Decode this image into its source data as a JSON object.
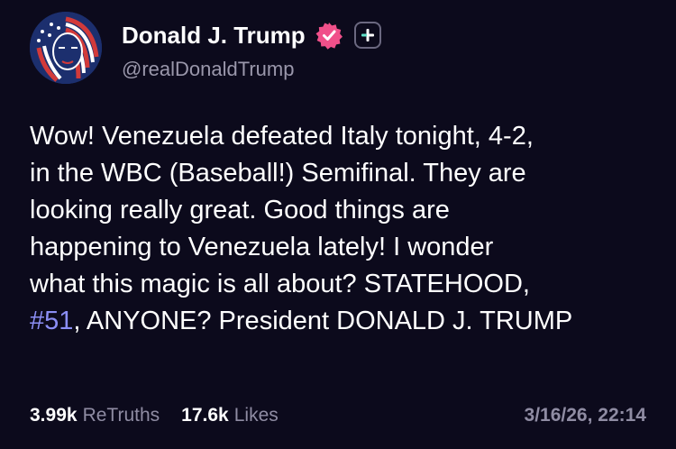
{
  "author": {
    "display_name": "Donald J. Trump",
    "handle": "@realDonaldTrump",
    "verified": true,
    "avatar_icon": "flag-portrait-avatar",
    "badge_color": "#f0508a"
  },
  "post": {
    "lines": [
      [
        {
          "text": "Wow! Venezuela defeated Italy tonight, 4-2,"
        }
      ],
      [
        {
          "text": "in the WBC (Baseball!) Semifinal. They are"
        }
      ],
      [
        {
          "text": "looking really great. Good things are"
        }
      ],
      [
        {
          "text": "happening to Venezuela lately! I wonder"
        }
      ],
      [
        {
          "text": "what this magic is all about? STATEHOOD,"
        }
      ],
      [
        {
          "text": "#51",
          "link": true
        },
        {
          "text": ", ANYONE? President DONALD J. TRUMP"
        }
      ]
    ],
    "hashtag_color": "#8b8ef4"
  },
  "stats": {
    "retruths_count": "3.99k",
    "retruths_label": "ReTruths",
    "likes_count": "17.6k",
    "likes_label": "Likes"
  },
  "timestamp": "3/16/26, 22:14"
}
